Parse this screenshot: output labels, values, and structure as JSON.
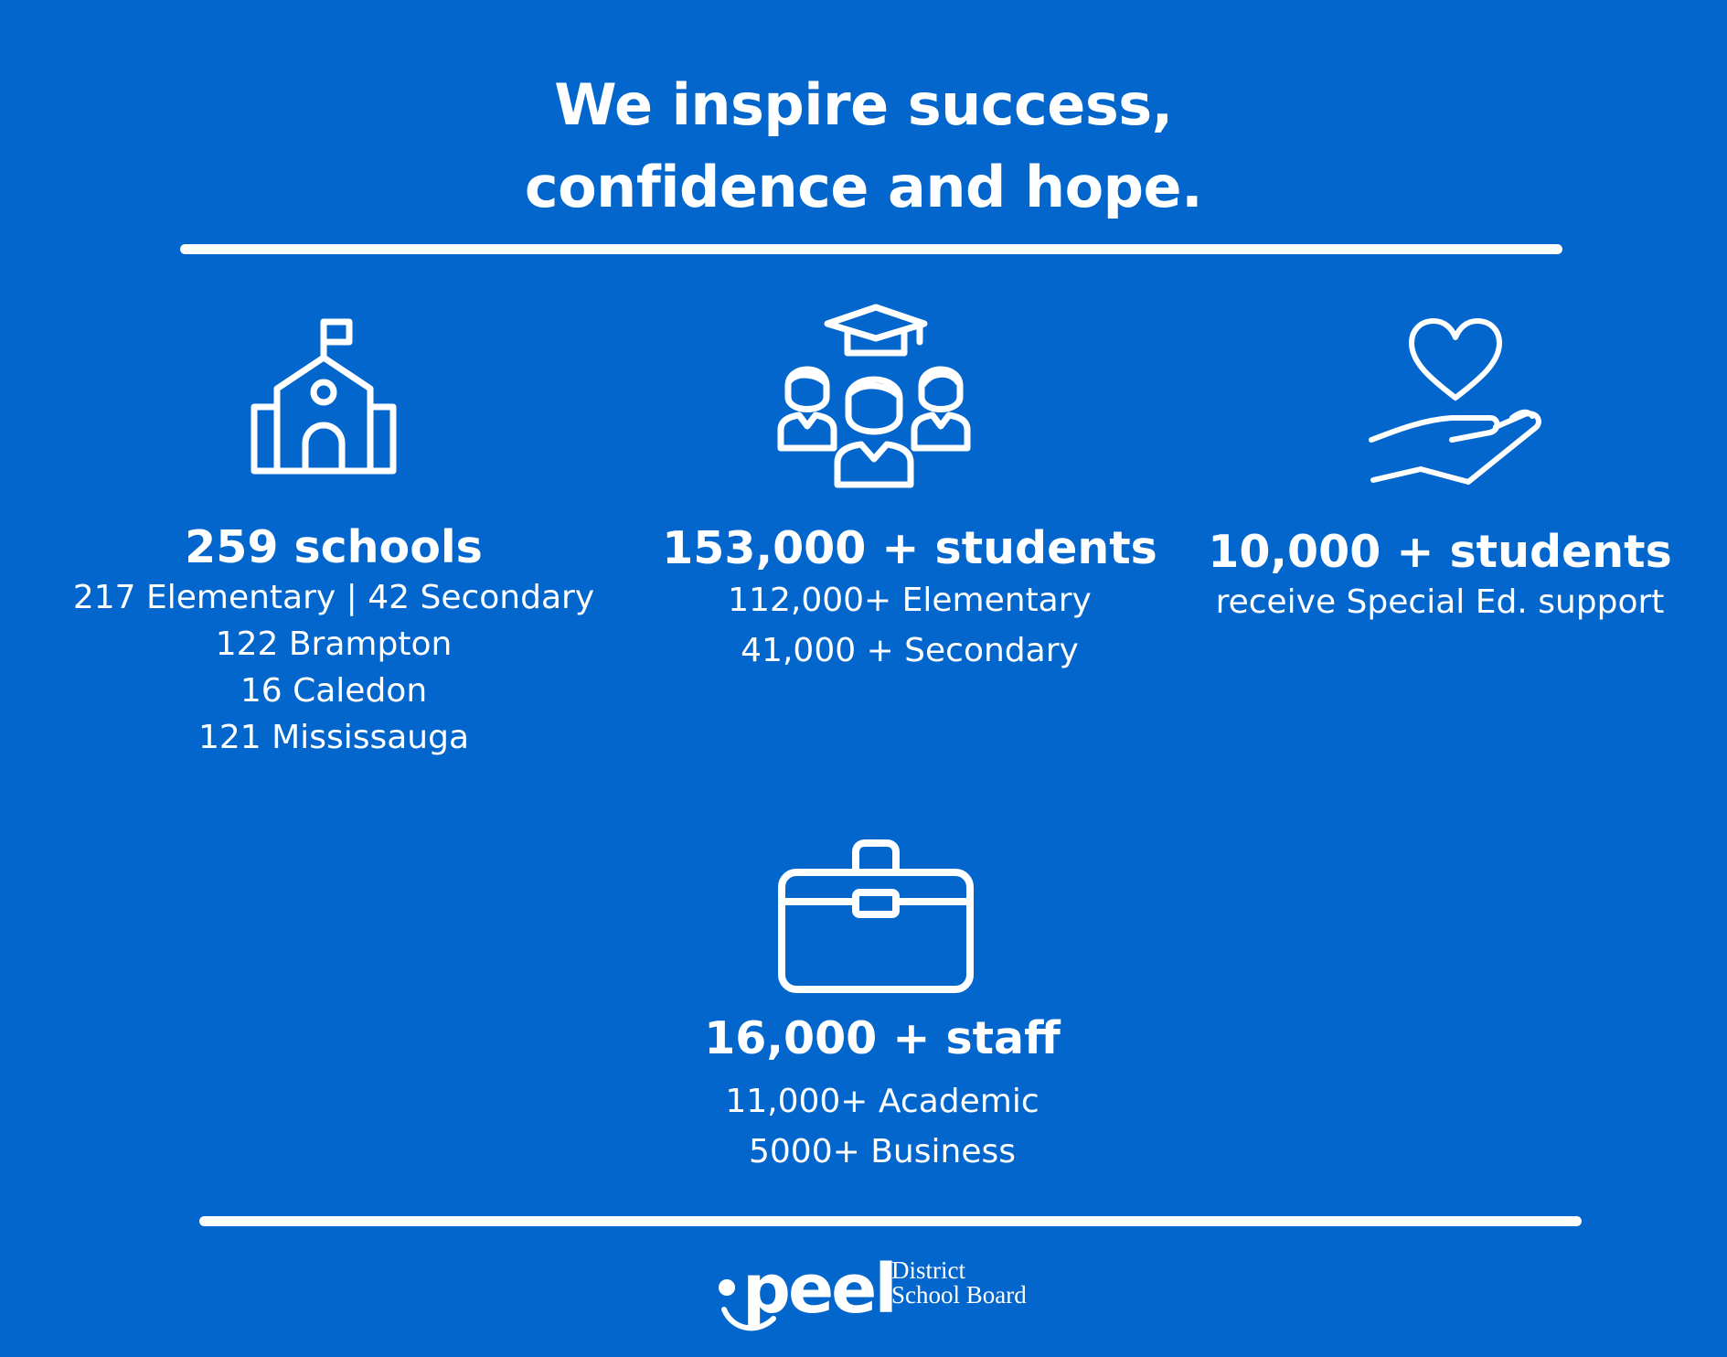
{
  "header": {
    "line1": "We inspire success,",
    "line2": "confidence and hope."
  },
  "stats": {
    "schools": {
      "headline": "259 schools",
      "lines": [
        "217 Elementary | 42 Secondary",
        "122 Brampton",
        "16 Caledon",
        "121 Mississauga"
      ],
      "icon": "school-building-icon"
    },
    "students": {
      "headline": "153,000 + students",
      "lines": [
        "112,000+ Elementary",
        "41,000 + Secondary"
      ],
      "icon": "graduates-group-icon"
    },
    "special_ed": {
      "headline": "10,000 + students",
      "lines": [
        "receive Special Ed. support"
      ],
      "icon": "heart-in-hand-icon"
    },
    "staff": {
      "headline": "16,000 + staff",
      "lines": [
        "11,000+ Academic",
        "5000+ Business"
      ],
      "icon": "briefcase-icon"
    }
  },
  "logo": {
    "wordmark": "peel",
    "sub_line1": "District",
    "sub_line2": "School Board"
  },
  "colors": {
    "background": "#0366cc",
    "foreground": "#ffffff"
  }
}
